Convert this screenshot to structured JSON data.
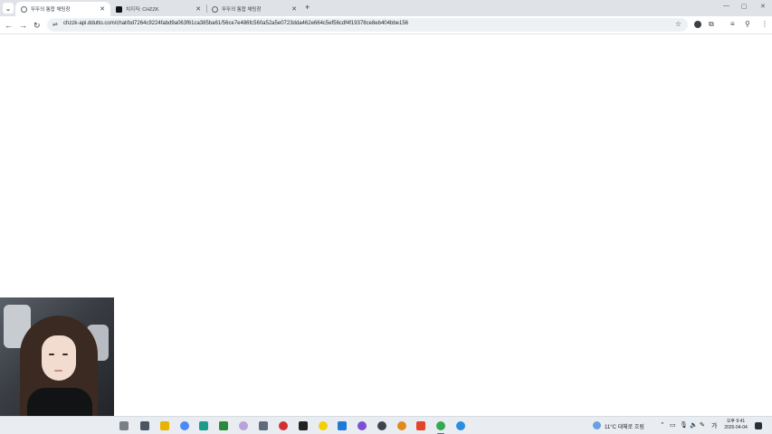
{
  "browser": {
    "tabs": [
      {
        "label": "뚜뚜의 통합 채팅창",
        "favicon": "globe-icon",
        "active": true
      },
      {
        "label": "치지직: CHZZK",
        "favicon": "chzzk-icon",
        "active": false
      },
      {
        "label": "뚜뚜의 통합 채팅창",
        "favicon": "globe-icon",
        "active": false
      }
    ],
    "address_bar": {
      "url": "chzzk-api.ddutto.com/chat/bd7264c9224fabd9a063f61ca385ba61/56ce7e486fc560a52a5e0723dda462e664c5ef56cdf4f19378ce8eb404bbe156"
    }
  },
  "taskbar": {
    "weather": "11°C  대체로 흐림",
    "ime": "가",
    "clock_time": "오후 9:41",
    "clock_date": "2026-04-04"
  }
}
